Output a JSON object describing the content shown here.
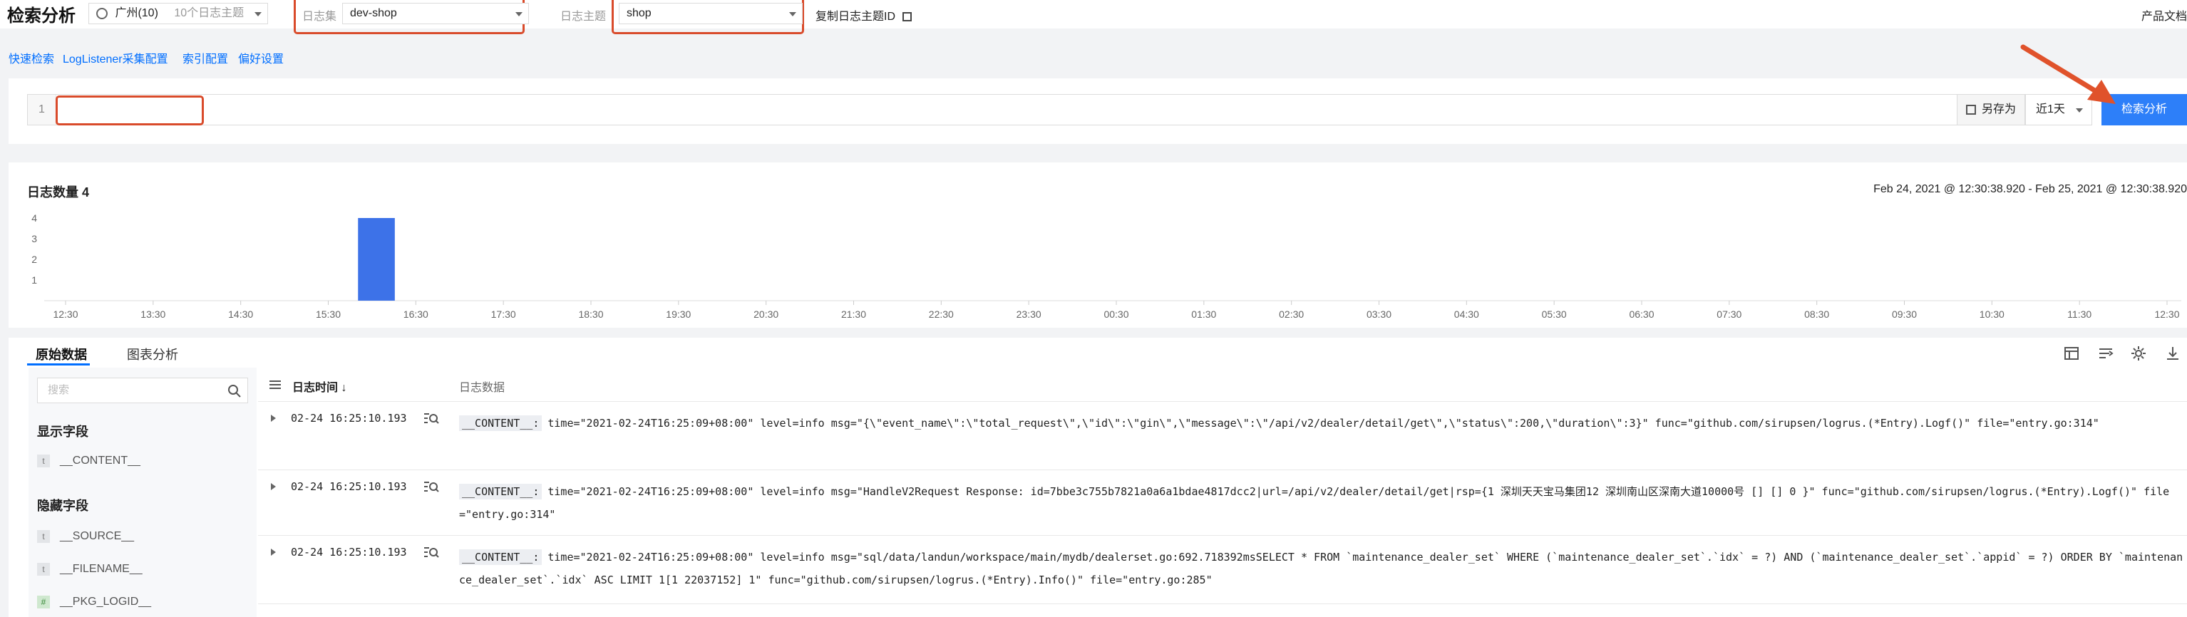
{
  "header": {
    "title": "检索分析",
    "region": "广州(10)",
    "topic_count": "10个日志主题",
    "logset_label": "日志集",
    "logset_value": "dev-shop",
    "topic_label": "日志主题",
    "topic_value": "shop",
    "copy_topic_id": "复制日志主题ID",
    "product_doc": "产品文档"
  },
  "links": [
    "快速检索",
    "LogListener采集配置",
    "索引配置",
    "偏好设置"
  ],
  "query": {
    "line_number": "1",
    "value": "",
    "save_as": "另存为",
    "time_range": "近1天",
    "search_button": "检索分析"
  },
  "chart": {
    "title": "日志数量 4",
    "time_range": "Feb 24, 2021 @ 12:30:38.920 - Feb 25, 2021 @ 12:30:38.920"
  },
  "chart_data": {
    "type": "bar",
    "title": "日志数量 4",
    "categories": [
      "12:30",
      "13:30",
      "14:30",
      "15:30",
      "16:30",
      "17:30",
      "18:30",
      "19:30",
      "20:30",
      "21:30",
      "22:30",
      "23:30",
      "00:30",
      "01:30",
      "02:30",
      "03:30",
      "04:30",
      "05:30",
      "06:30",
      "07:30",
      "08:30",
      "09:30",
      "10:30",
      "11:30",
      "12:30"
    ],
    "bars": [
      {
        "x_start": "15:30",
        "x_end": "16:30",
        "value": 4
      }
    ],
    "y_ticks": [
      1,
      2,
      3,
      4
    ],
    "ylim": [
      0,
      4
    ],
    "bar_color": "#3d72e8",
    "grid": true
  },
  "tabs": [
    "原始数据",
    "图表分析"
  ],
  "sidebar": {
    "search_placeholder": "搜索",
    "shown_title": "显示字段",
    "shown_fields": [
      "__CONTENT__"
    ],
    "hidden_title": "隐藏字段",
    "hidden_fields": [
      "__SOURCE__",
      "__FILENAME__",
      "__PKG_LOGID__"
    ]
  },
  "table": {
    "col_time": "日志时间",
    "col_data": "日志数据",
    "rows": [
      {
        "time": "02-24 16:25:10.193",
        "key": "__CONTENT__:",
        "text": "time=\"2021-02-24T16:25:09+08:00\" level=info msg=\"{\\\"event_name\\\":\\\"total_request\\\",\\\"id\\\":\\\"gin\\\",\\\"message\\\":\\\"/api/v2/dealer/detail/get\\\",\\\"status\\\":200,\\\"duration\\\":3}\" func=\"github.com/sirupsen/logrus.(*Entry).Logf()\" file=\"entry.go:314\""
      },
      {
        "time": "02-24 16:25:10.193",
        "key": "__CONTENT__:",
        "text": "time=\"2021-02-24T16:25:09+08:00\" level=info msg=\"HandleV2Request Response: id=7bbe3c755b7821a0a6a1bdae4817dcc2|url=/api/v2/dealer/detail/get|rsp={1 深圳天天宝马集团12 深圳南山区深南大道10000号   [] []  0 }\" func=\"github.com/sirupsen/logrus.(*Entry).Logf()\" file=\"entry.go:314\""
      },
      {
        "time": "02-24 16:25:10.193",
        "key": "__CONTENT__:",
        "text": "time=\"2021-02-24T16:25:09+08:00\" level=info msg=\"sql/data/landun/workspace/main/mydb/dealerset.go:692.718392msSELECT * FROM `maintenance_dealer_set`  WHERE (`maintenance_dealer_set`.`idx` = ?) AND (`maintenance_dealer_set`.`appid` = ?) ORDER BY `maintenance_dealer_set`.`idx` ASC LIMIT 1[1 22037152] 1\" func=\"github.com/sirupsen/logrus.(*Entry).Info()\" file=\"entry.go:285\""
      }
    ]
  }
}
